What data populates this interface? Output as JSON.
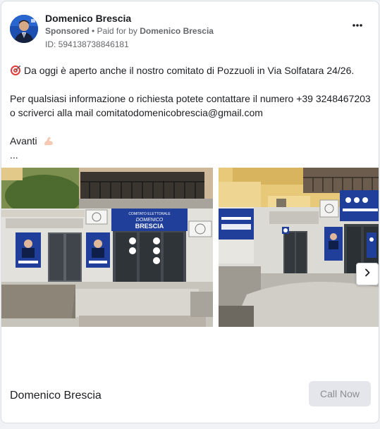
{
  "post": {
    "author_name": "Domenico Brescia",
    "sponsored_label": "Sponsored",
    "paid_for_prefix": " • Paid for by ",
    "paid_for_name": "Domenico Brescia",
    "ad_id": "ID: 594138738846181",
    "more_icon": "more-horizontal-icon",
    "text": {
      "line1": "Da oggi è aperto anche il nostro comitato di Pozzuoli in Via Solfatara 24/26.",
      "line2": "Per qualsiasi informazione o richiesta potete contattare il numero +39 3248467203 o scriverci alla mail comitatodomenicobrescia@gmail.com",
      "line3": "Avanti",
      "ellipsis": "..."
    },
    "emojis": {
      "target": "target-emoji",
      "flex": "flexed-biceps-emoji"
    }
  },
  "carousel": {
    "sign_line1": "COMITATO ELETTORALE",
    "sign_line2": "DOMENICO",
    "sign_line3": "BRESCIA",
    "next_icon": "chevron-right-icon"
  },
  "footer": {
    "name": "Domenico Brescia",
    "cta_label": "Call Now"
  },
  "colors": {
    "sign_blue": "#1f3f9a",
    "cta_bg": "#e4e6eb",
    "cta_text": "#8a8d91"
  }
}
